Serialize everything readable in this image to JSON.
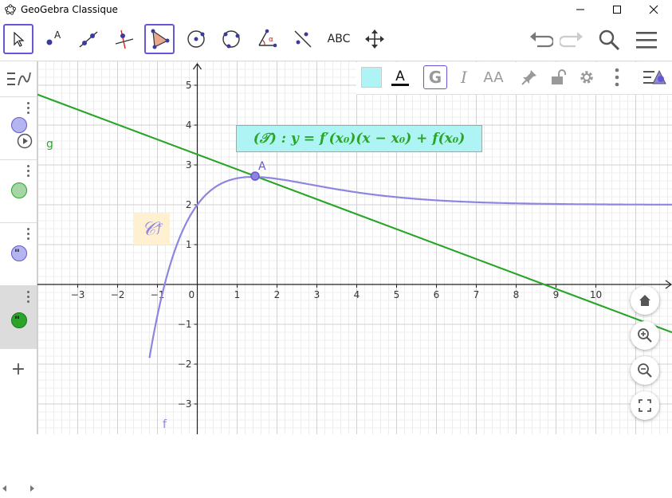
{
  "window": {
    "title": "GeoGebra Classique"
  },
  "toolbar": {
    "abc_label": "ABC"
  },
  "stylebar": {
    "text_label": "A",
    "bold_label": "G",
    "italic_label": "I",
    "size_label": "AA"
  },
  "algebra": {
    "rows": [
      {
        "name": "g",
        "color": "#b4b4f0"
      },
      {
        "name": "",
        "color": "#a5d6a5"
      },
      {
        "name": "",
        "color": "#b4b4f0"
      },
      {
        "name": "",
        "color": "#2aa52a"
      }
    ],
    "g_label": "g",
    "add_label": "+"
  },
  "graph": {
    "x_ticks": [
      "−3",
      "−2",
      "−1",
      "0",
      "1",
      "2",
      "3",
      "4",
      "5",
      "6",
      "7",
      "8",
      "9",
      "10"
    ],
    "y_ticks": [
      "5",
      "4",
      "3",
      "2",
      "1",
      "−1",
      "−2",
      "−3"
    ],
    "point_label": "A",
    "curve_label": "f",
    "line_label": "g",
    "tangent_equation": "(𝒯) : y = f′(x₀)(x − x₀) + f(x₀)",
    "cf_label": "𝒞",
    "cf_sub": "f",
    "colors": {
      "curve": "#8d86e0",
      "line": "#2aa52a",
      "point": "#6557d2"
    }
  }
}
